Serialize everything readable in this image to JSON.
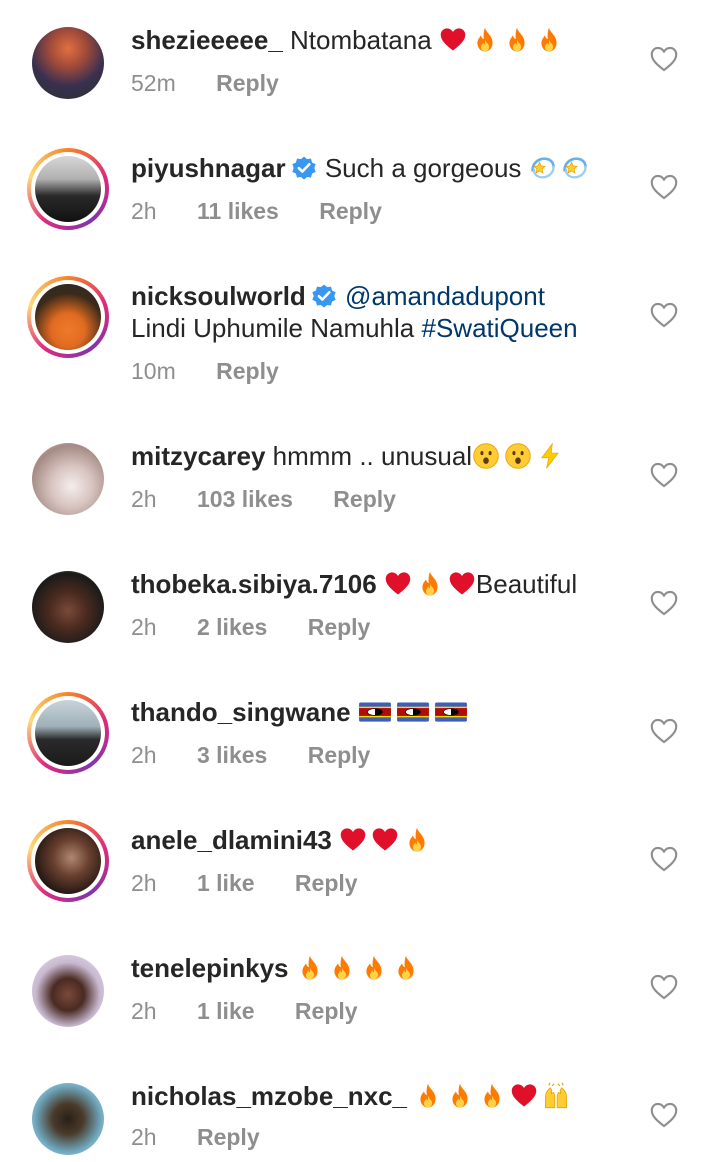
{
  "comments": [
    {
      "username": "shezieeeee_",
      "verified": false,
      "text": "Ntombatana",
      "emojis": [
        "heart",
        "fire",
        "fire",
        "fire"
      ],
      "time": "52m",
      "likes": "",
      "reply": "Reply",
      "story_ring": false,
      "avatar_colors": [
        "#3a2a4a",
        "#d9714a",
        "#2b3b2f"
      ]
    },
    {
      "username": "piyushnagar",
      "verified": true,
      "text": "Such a gorgeous",
      "emojis": [
        "dizzy",
        "dizzy"
      ],
      "time": "2h",
      "likes": "11 likes",
      "reply": "Reply",
      "story_ring": true,
      "avatar_colors": [
        "#c9c9c9",
        "#1a1a1a",
        "#8a8a8a"
      ]
    },
    {
      "username": "nicksoulworld",
      "verified": true,
      "mention": "@amandadupont",
      "text": "Lindi Uphumile Namuhla ",
      "hashtag": "#SwatiQueen",
      "emojis": [],
      "time": "10m",
      "likes": "",
      "reply": "Reply",
      "story_ring": true,
      "avatar_colors": [
        "#2a2a2a",
        "#f07a2a",
        "#3a2a1a"
      ]
    },
    {
      "username": "mitzycarey",
      "verified": false,
      "text": "hmmm .. unusual",
      "emojis": [
        "hushed",
        "hushed",
        "zap"
      ],
      "time": "2h",
      "likes": "103 likes",
      "reply": "Reply",
      "story_ring": false,
      "avatar_colors": [
        "#e8dcd8",
        "#b49a94",
        "#f2ecea"
      ]
    },
    {
      "username": "thobeka.sibiya.7106",
      "verified": false,
      "text": "Beautiful",
      "emojis": [
        "heart",
        "fire",
        "heart"
      ],
      "emoji_first": true,
      "time": "2h",
      "likes": "2 likes",
      "reply": "Reply",
      "story_ring": false,
      "avatar_colors": [
        "#1a1a1a",
        "#7a4a3a",
        "#e0c070"
      ]
    },
    {
      "username": "thando_singwane",
      "verified": false,
      "text": "",
      "emojis": [
        "flag",
        "flag",
        "flag"
      ],
      "time": "2h",
      "likes": "3 likes",
      "reply": "Reply",
      "story_ring": true,
      "avatar_colors": [
        "#9fb0b8",
        "#2a2a2a",
        "#d0d8dc"
      ]
    },
    {
      "username": "anele_dlamini43",
      "verified": false,
      "text": "",
      "emojis": [
        "heart",
        "heart",
        "fire"
      ],
      "time": "2h",
      "likes": "1 like",
      "reply": "Reply",
      "story_ring": true,
      "avatar_colors": [
        "#1e1410",
        "#6a4030",
        "#b08870"
      ]
    },
    {
      "username": "tenelepinkys",
      "verified": false,
      "text": "",
      "emojis": [
        "fire",
        "fire",
        "fire",
        "fire"
      ],
      "time": "2h",
      "likes": "1 like",
      "reply": "Reply",
      "story_ring": false,
      "avatar_colors": [
        "#e9e6ef",
        "#4a2a22",
        "#c8b8d0"
      ]
    },
    {
      "username": "nicholas_mzobe_nxc_",
      "verified": false,
      "text": "",
      "emojis": [
        "fire",
        "fire",
        "fire",
        "heart",
        "raised-hands"
      ],
      "time": "2h",
      "likes": "",
      "reply": "Reply",
      "story_ring": false,
      "avatar_colors": [
        "#6fa9c0",
        "#2a2018",
        "#f0d030"
      ]
    }
  ],
  "icons": {
    "like_icon": "heart-outline-icon",
    "verified_icon": "verified-badge-icon"
  },
  "colors": {
    "username": "#262626",
    "meta": "#8e8e8e",
    "link": "#00376b",
    "verified": "#3897f0",
    "heart_emoji": "#e0102a",
    "fire_emoji": "#ff7a00"
  }
}
